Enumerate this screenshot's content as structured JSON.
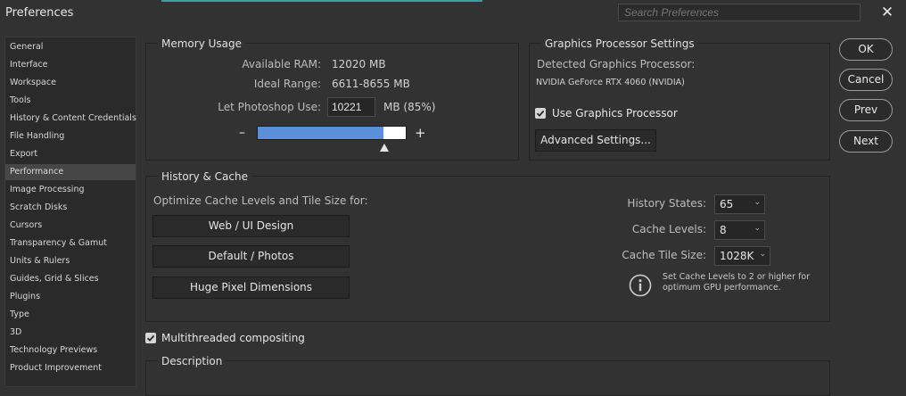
{
  "window": {
    "title": "Preferences",
    "search_placeholder": "Search Preferences",
    "close_glyph": "✕"
  },
  "sidebar": {
    "items": [
      {
        "label": "General"
      },
      {
        "label": "Interface"
      },
      {
        "label": "Workspace"
      },
      {
        "label": "Tools"
      },
      {
        "label": "History & Content Credentials"
      },
      {
        "label": "File Handling"
      },
      {
        "label": "Export"
      },
      {
        "label": "Performance",
        "selected": true
      },
      {
        "label": "Image Processing"
      },
      {
        "label": "Scratch Disks"
      },
      {
        "label": "Cursors"
      },
      {
        "label": "Transparency & Gamut"
      },
      {
        "label": "Units & Rulers"
      },
      {
        "label": "Guides, Grid & Slices"
      },
      {
        "label": "Plugins"
      },
      {
        "label": "Type"
      },
      {
        "label": "3D"
      },
      {
        "label": "Technology Previews"
      },
      {
        "label": "Product Improvement"
      }
    ]
  },
  "memory": {
    "title": "Memory Usage",
    "available_label": "Available RAM:",
    "available_value": "12020 MB",
    "ideal_label": "Ideal Range:",
    "ideal_value": "6611-8655 MB",
    "use_label": "Let Photoshop Use:",
    "use_value": "10221",
    "use_unit": "MB (85%)",
    "minus": "–",
    "plus": "+",
    "slider_fraction": 0.85,
    "slider_fill_color": "#5b8fd9"
  },
  "gpu": {
    "title": "Graphics Processor Settings",
    "detected_label": "Detected Graphics Processor:",
    "detected_value": "NVIDIA GeForce RTX 4060 (NVIDIA)",
    "use_label": "Use Graphics Processor",
    "use_checked": true,
    "advanced_button": "Advanced Settings..."
  },
  "history_cache": {
    "title": "History & Cache",
    "optimize_label": "Optimize Cache Levels and Tile Size for:",
    "buttons": [
      "Web / UI Design",
      "Default / Photos",
      "Huge Pixel Dimensions"
    ],
    "history_states_label": "History States:",
    "history_states_value": "65",
    "cache_levels_label": "Cache Levels:",
    "cache_levels_value": "8",
    "tile_size_label": "Cache Tile Size:",
    "tile_size_value": "1028K",
    "info_text_1": "Set Cache Levels to 2 or higher for",
    "info_text_2": "optimum GPU performance."
  },
  "multithreaded": {
    "label": "Multithreaded compositing",
    "checked": true
  },
  "description": {
    "title": "Description"
  },
  "actions": {
    "ok": "OK",
    "cancel": "Cancel",
    "prev": "Prev",
    "next": "Next"
  }
}
